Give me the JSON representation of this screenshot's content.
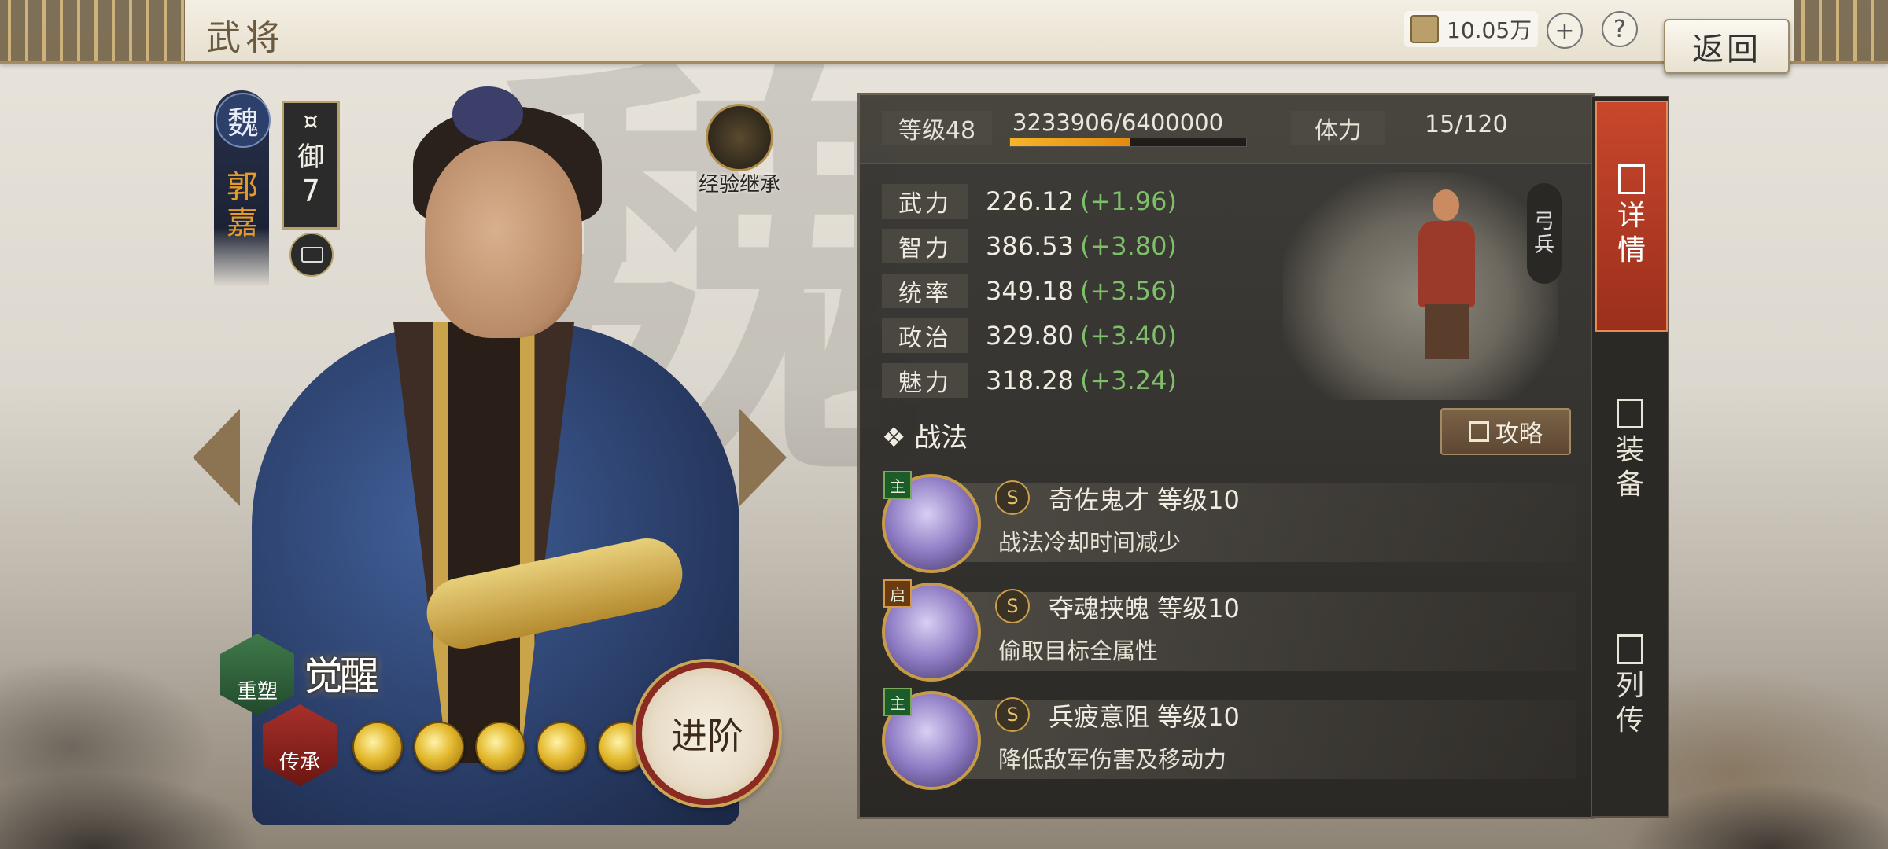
{
  "header": {
    "title": "武将",
    "currency": "10.05万",
    "add_label": "+",
    "help_label": "?",
    "back_label": "返回"
  },
  "hero": {
    "faction": "魏",
    "name": "郭嘉",
    "troop_symbol": "¤",
    "troop_type": "御",
    "troop_level": "7",
    "exp_inherit_label": "经验继承",
    "watermark": "魏"
  },
  "actions": {
    "rebuild_label": "重塑",
    "inherit_label": "传承",
    "awaken_label": "觉醒",
    "advance_label": "进阶",
    "advance_stars": 5
  },
  "panel": {
    "level_label": "等级48",
    "exp": "3233906/6400000",
    "exp_fraction": 0.505,
    "stamina_label": "体力",
    "stamina_value": "15/120",
    "stats": [
      {
        "label": "武力",
        "value": "226.12",
        "bonus": "(+1.96)"
      },
      {
        "label": "智力",
        "value": "386.53",
        "bonus": "(+3.80)"
      },
      {
        "label": "统率",
        "value": "349.18",
        "bonus": "(+3.56)"
      },
      {
        "label": "政治",
        "value": "329.80",
        "bonus": "(+3.40)"
      },
      {
        "label": "魅力",
        "value": "318.28",
        "bonus": "(+3.24)"
      }
    ],
    "unit_type": [
      "弓",
      "兵"
    ],
    "tactics_title": "战法",
    "tactics_guide": "攻略",
    "tactics": [
      {
        "badge": "主",
        "grade": "S",
        "name": "奇佐鬼才  等级10",
        "desc": "战法冷却时间减少"
      },
      {
        "badge": "启",
        "grade": "S",
        "name": "夺魂挟魄  等级10",
        "desc": "偷取目标全属性"
      },
      {
        "badge": "主",
        "grade": "S",
        "name": "兵疲意阻  等级10",
        "desc": "降低敌军伤害及移动力"
      }
    ]
  },
  "tabs": [
    {
      "label1": "详",
      "label2": "情",
      "active": true
    },
    {
      "label1": "装",
      "label2": "备",
      "active": false
    },
    {
      "label1": "列",
      "label2": "传",
      "active": false
    }
  ]
}
